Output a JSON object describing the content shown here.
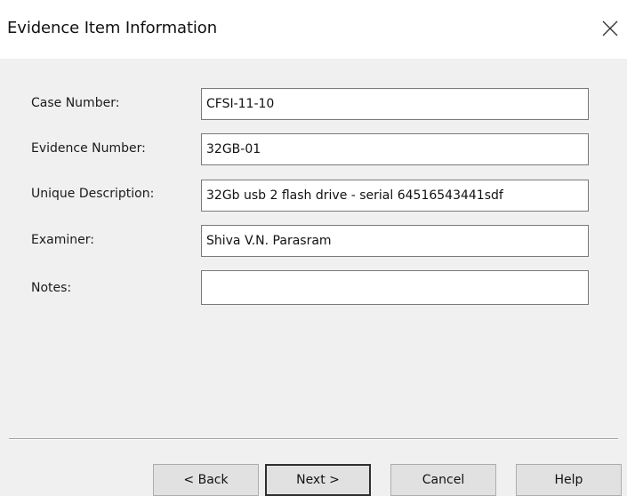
{
  "window": {
    "title": "Evidence Item Information",
    "close_symbol": "✕",
    "close_icon": "close-icon"
  },
  "form": {
    "case_number": {
      "label": "Case Number:",
      "value": "CFSI-11-10"
    },
    "evidence_number": {
      "label": "Evidence Number:",
      "value": "32GB-01"
    },
    "unique_description": {
      "label": "Unique Description:",
      "value": "32Gb usb 2 flash drive - serial 64516543441sdf"
    },
    "examiner": {
      "label": "Examiner:",
      "value": "Shiva V.N. Parasram"
    },
    "notes": {
      "label": "Notes:",
      "value": ""
    }
  },
  "buttons": {
    "back": "< Back",
    "next": "Next >",
    "cancel": "Cancel",
    "help": "Help"
  },
  "colors": {
    "dialog_background": "#f0f0f0",
    "titlebar_background": "#ffffff",
    "input_border": "#7a7a7a",
    "button_face": "#e1e1e1"
  }
}
